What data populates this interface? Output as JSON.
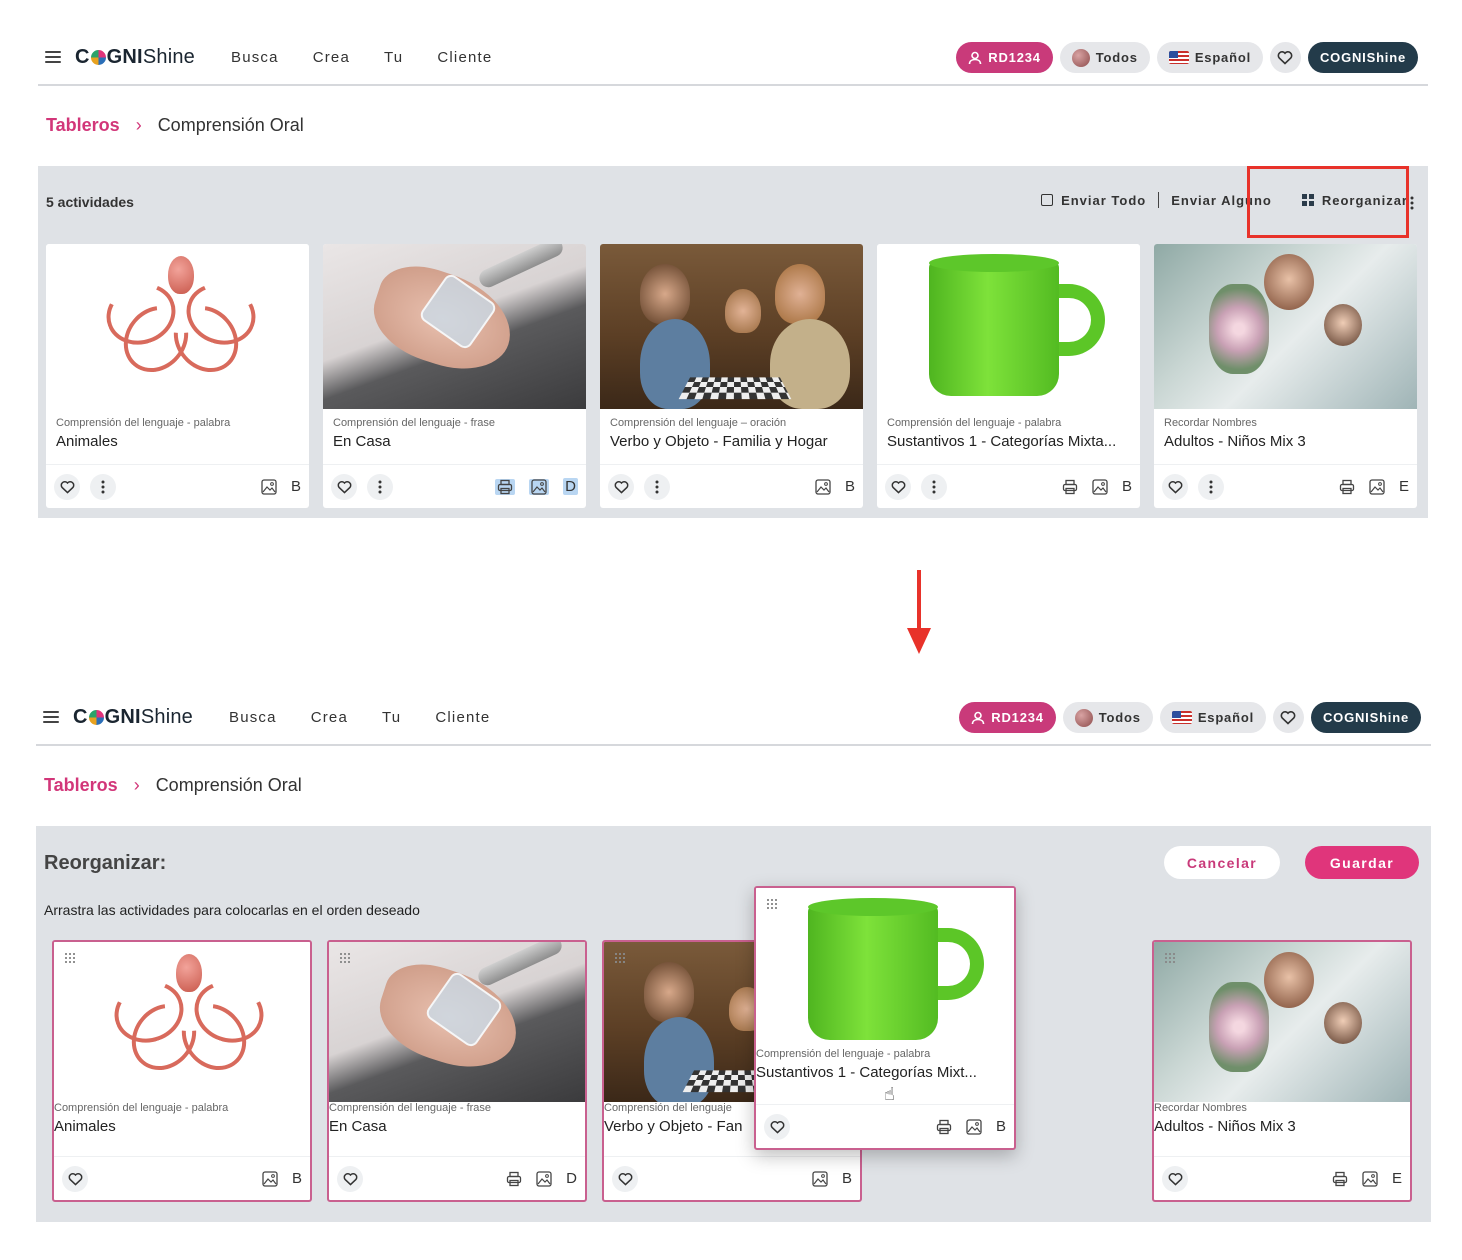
{
  "header": {
    "logo_prefix": "C",
    "logo_bold": "GNI",
    "logo_suffix": "Shine",
    "nav": [
      "Busca",
      "Crea",
      "Tu",
      "Cliente"
    ],
    "user_pill": "RD1234",
    "group_pill": "Todos",
    "language_pill": "Español",
    "brand_pill": "COGNIShine"
  },
  "breadcrumb": {
    "root": "Tableros",
    "current": "Comprensión Oral"
  },
  "screen1": {
    "count": "5 actividades",
    "actions": {
      "send_all": "Enviar Todo",
      "send_some": "Enviar Alguno",
      "reorganize": "Reorganizar"
    }
  },
  "cards": [
    {
      "category": "Comprensión del lenguaje - palabra",
      "title": "Animales",
      "letter": "B",
      "print": false,
      "thumb": "octopus"
    },
    {
      "category": "Comprensión del lenguaje - frase",
      "title": "En Casa",
      "letter": "D",
      "print": true,
      "thumb": "water"
    },
    {
      "category": "Comprensión del lenguaje – oración",
      "title": "Verbo y Objeto - Familia y Hogar",
      "letter": "B",
      "print": false,
      "thumb": "chess"
    },
    {
      "category": "Comprensión del lenguaje - palabra",
      "title": "Sustantivos 1 - Categorías Mixta...",
      "letter": "B",
      "print": true,
      "thumb": "mug"
    },
    {
      "category": "Recordar Nombres",
      "title": "Adultos - Niños Mix 3",
      "letter": "E",
      "print": true,
      "thumb": "flowers"
    }
  ],
  "screen2": {
    "title": "Reorganizar:",
    "subtitle": "Arrastra las actividades para colocarlas en el orden deseado",
    "cancel": "Cancelar",
    "save": "Guardar",
    "cards": [
      {
        "category": "Comprensión del lenguaje - palabra",
        "title": "Animales",
        "letter": "B"
      },
      {
        "category": "Comprensión del lenguaje - frase",
        "title": "En Casa",
        "letter": "D"
      },
      {
        "category": "Comprensión del lenguaje",
        "title": "Verbo y Objeto - Fan",
        "letter": "B"
      },
      {
        "category": "Recordar Nombres",
        "title": "Adultos - Niños Mix 3",
        "letter": "E"
      }
    ],
    "dragging": {
      "category": "Comprensión del lenguaje - palabra",
      "title": "Sustantivos 1 - Categorías Mixt...",
      "letter": "B"
    }
  },
  "colors": {
    "accent": "#d23679",
    "brand_dark": "#233b4a",
    "highlight_box": "#e8322a",
    "panel_bg": "#dfe2e6"
  }
}
